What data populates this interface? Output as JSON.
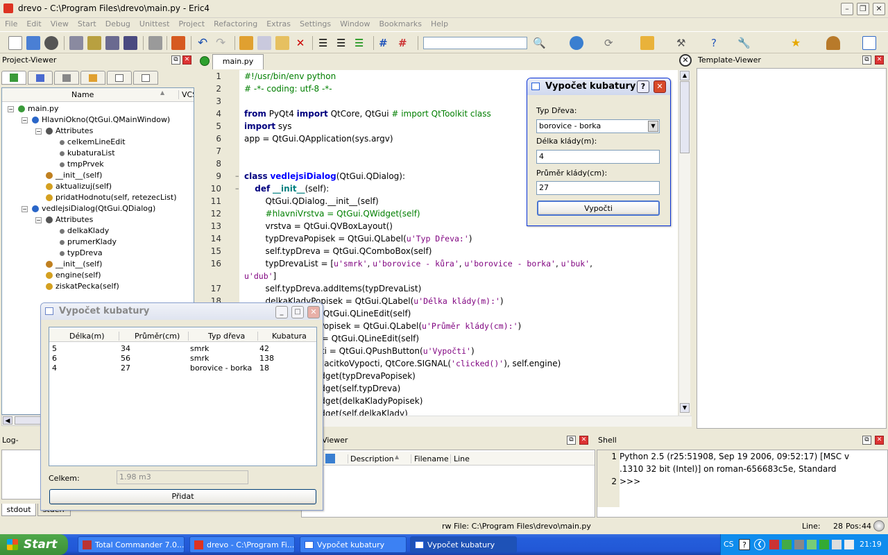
{
  "window": {
    "title": "drevo - C:\\Program Files\\drevo\\main.py - Eric4"
  },
  "menu": [
    "File",
    "Edit",
    "View",
    "Start",
    "Debug",
    "Unittest",
    "Project",
    "Refactoring",
    "Extras",
    "Settings",
    "Window",
    "Bookmarks",
    "Help"
  ],
  "project_viewer": {
    "title": "Project-Viewer",
    "columns": {
      "name": "Name",
      "vcs": "VCS"
    },
    "tree": [
      {
        "label": "main.py",
        "depth": 0,
        "icon": "python-file-icon"
      },
      {
        "label": "HlavniOkno(QtGui.QMainWindow)",
        "depth": 1,
        "icon": "class-icon"
      },
      {
        "label": "Attributes",
        "depth": 2,
        "icon": "attributes-icon"
      },
      {
        "label": "celkemLineEdit",
        "depth": 3,
        "icon": "attribute-icon"
      },
      {
        "label": "kubaturaList",
        "depth": 3,
        "icon": "attribute-icon"
      },
      {
        "label": "tmpPrvek",
        "depth": 3,
        "icon": "attribute-icon"
      },
      {
        "label": "__init__(self)",
        "depth": 2,
        "icon": "constructor-icon"
      },
      {
        "label": "aktualizuj(self)",
        "depth": 2,
        "icon": "method-icon"
      },
      {
        "label": "pridatHodnotu(self, retezecList)",
        "depth": 2,
        "icon": "method-icon"
      },
      {
        "label": "vedlejsiDialog(QtGui.QDialog)",
        "depth": 1,
        "icon": "class-icon"
      },
      {
        "label": "Attributes",
        "depth": 2,
        "icon": "attributes-icon"
      },
      {
        "label": "delkaKlady",
        "depth": 3,
        "icon": "attribute-icon"
      },
      {
        "label": "prumerKlady",
        "depth": 3,
        "icon": "attribute-icon"
      },
      {
        "label": "typDreva",
        "depth": 3,
        "icon": "attribute-icon"
      },
      {
        "label": "__init__(self)",
        "depth": 2,
        "icon": "constructor-icon"
      },
      {
        "label": "engine(self)",
        "depth": 2,
        "icon": "method-icon"
      },
      {
        "label": "ziskatPecka(self)",
        "depth": 2,
        "icon": "method-icon"
      }
    ]
  },
  "editor": {
    "tab": "main.py",
    "lines": [
      {
        "n": "1",
        "html": "<span class='cm'>#!/usr/bin/env python</span>"
      },
      {
        "n": "2",
        "html": "<span class='cm'># -*- coding: utf-8 -*-</span>"
      },
      {
        "n": "3",
        "html": ""
      },
      {
        "n": "4",
        "html": "<span class='kw'>from</span> PyQt4 <span class='kw'>import</span> QtCore, QtGui <span class='cm'># import QtToolkit class</span>"
      },
      {
        "n": "5",
        "html": "<span class='kw'>import</span> sys"
      },
      {
        "n": "6",
        "html": "app = QtGui.QApplication(sys.argv)"
      },
      {
        "n": "7",
        "html": ""
      },
      {
        "n": "8",
        "html": ""
      },
      {
        "n": "9",
        "html": "<span class='kw'>class</span> <span class='cls'>vedlejsiDialog</span>(QtGui.QDialog):"
      },
      {
        "n": "10",
        "html": "    <span class='kw'>def</span> <span class='fn'>__init__</span>(self):"
      },
      {
        "n": "11",
        "html": "        QtGui.QDialog.__init__(self)"
      },
      {
        "n": "12",
        "html": "        <span class='cm'>#hlavniVrstva = QtGui.QWidget(self)</span>"
      },
      {
        "n": "13",
        "html": "        vrstva = QtGui.QVBoxLayout()"
      },
      {
        "n": "14",
        "html": "        typDrevaPopisek = QtGui.QLabel(<span class='st'>u'Typ Dřeva:'</span>)"
      },
      {
        "n": "15",
        "html": "        self.typDreva = QtGui.QComboBox(self)"
      },
      {
        "n": "16",
        "html": "        typDrevaList = [<span class='st'>u'smrk'</span>, <span class='st'>u'borovice - kůra'</span>, <span class='st'>u'borovice - borka'</span>, <span class='st'>u'buk'</span>,"
      },
      {
        "n": "",
        "html": "<span class='st'>u'dub'</span>]"
      },
      {
        "n": "17",
        "html": "        self.typDreva.addItems(typDrevaList)"
      },
      {
        "n": "18",
        "html": "        delkaKladyPopisek = QtGui.QLabel(<span class='st'>u'Délka klády(m):'</span>)"
      },
      {
        "n": "19",
        "html": "        delkaKlady = QtGui.QLineEdit(self)"
      },
      {
        "n": "20",
        "html": "        prumerKladyPopisek = QtGui.QLabel(<span class='st'>u'Průměr klády(cm):'</span>)"
      },
      {
        "n": "21",
        "html": "        prumerKlady = QtGui.QLineEdit(self)"
      },
      {
        "n": "22",
        "html": "        tlacitkoVypocti = QtGui.QPushButton(<span class='st'>u'Vypočti'</span>)"
      },
      {
        "n": "23",
        "html": "        self.connect(tlacitkoVypocti, QtCore.SIGNAL(<span class='st'>'clicked()'</span>), self.engine)"
      },
      {
        "n": "24",
        "html": "        vrstva.addWidget(typDrevaPopisek)"
      },
      {
        "n": "25",
        "html": "        vrstva.addWidget(self.typDreva)"
      },
      {
        "n": "26",
        "html": "        vrstva.addWidget(delkaKladyPopisek)"
      },
      {
        "n": "27",
        "html": "        vrstva.addWidget(self.delkaKlady)"
      }
    ]
  },
  "template_viewer": {
    "title": "Template-Viewer"
  },
  "log_viewer": {
    "title": "Log-Viewer",
    "tabs": [
      "stdout",
      "stderr"
    ]
  },
  "task_viewer": {
    "title": "Task-Viewer",
    "columns": [
      "Description",
      "Filename",
      "Line"
    ]
  },
  "shell": {
    "title": "Shell",
    "lines": [
      {
        "n": "1",
        "text": "Python 2.5 (r25:51908, Sep 19 2006, 09:52:17) [MSC v"
      },
      {
        "n": "",
        "text": ".1310 32 bit (Intel)] on roman-656683c5e, Standard"
      },
      {
        "n": "2",
        "text": ">>>"
      }
    ]
  },
  "statusbar": {
    "file": "rw File: C:\\Program Files\\drevo\\main.py",
    "line_label": "Line:",
    "line": "28",
    "pos_label": "Pos:",
    "pos": "44"
  },
  "dialog_input": {
    "title": "Vypočet kubatury",
    "type_label": "Typ Dřeva:",
    "type_value": "borovice - borka",
    "length_label": "Délka klády(m):",
    "length_value": "4",
    "diameter_label": "Průměr klády(cm):",
    "diameter_value": "27",
    "compute_button": "Vypočti"
  },
  "dialog_main": {
    "title": "Vypočet kubatury",
    "columns": [
      "Délka(m)",
      "Průměr(cm)",
      "Typ dřeva",
      "Kubatura"
    ],
    "rows": [
      [
        "5",
        "34",
        "smrk",
        "42"
      ],
      [
        "6",
        "56",
        "smrk",
        "138"
      ],
      [
        "4",
        "27",
        "borovice - borka",
        "18"
      ]
    ],
    "total_label": "Celkem:",
    "total_value": "1.98 m3",
    "add_button": "Přidat"
  },
  "taskbar": {
    "start": "Start",
    "tasks": [
      "Total Commander 7.0...",
      "drevo - C:\\Program Fi...",
      "Vypočet kubatury",
      "Vypočet kubatury"
    ],
    "lang": "CS",
    "clock": "21:19"
  },
  "colors": {
    "taskbar": "#245edb",
    "start": "#3c8f37",
    "keyword": "#00007f",
    "comment": "#007f00",
    "string": "#7f007f"
  }
}
